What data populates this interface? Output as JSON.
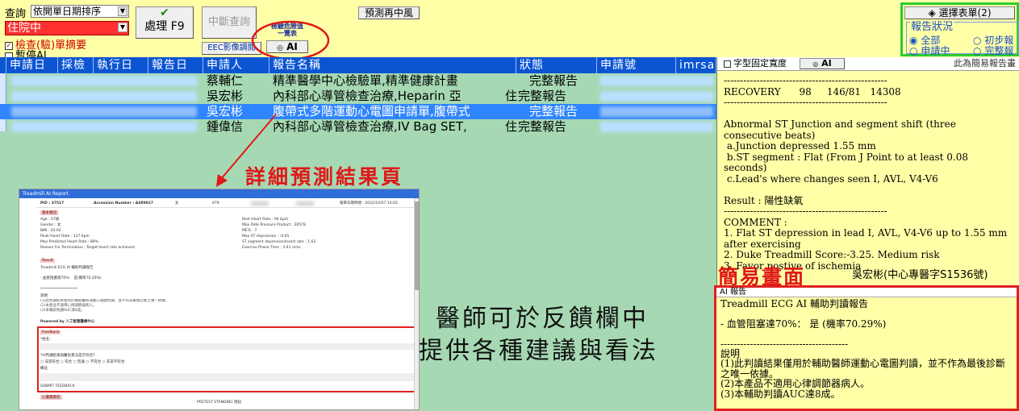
{
  "toolbar": {
    "query_label": "查詢",
    "sort_value": "依開單日期排序",
    "ward_value": "住院中",
    "exam_summary_label": "檢查(驗)單摘要",
    "pause_ai_label": "暫停AI",
    "process_button": "處理 F9",
    "interrupt_button": "中斷查詢",
    "eec_button": "EEC影像調閱",
    "critical_values_label_1": "檢驗危險值",
    "critical_values_label_2": "一覽表",
    "ai_button": "AI",
    "predict_button": "預測再中風",
    "select_form_button": "選擇表單(2)",
    "report_status_label": "報告狀況",
    "status_all": "全部",
    "status_applying": "申請中",
    "status_preliminary": "初步報",
    "status_complete": "完整報"
  },
  "table": {
    "headers": [
      "申請日",
      "採檢",
      "執行日",
      "報告日",
      "申請人",
      "報告名稱",
      "狀態",
      "申請號",
      "imrsan"
    ],
    "rows": [
      {
        "applicant": "蔡輔仁",
        "report": "精準醫學中心檢驗單,精準健康計畫",
        "status": "完整報告"
      },
      {
        "applicant": "吳宏彬",
        "report": "內科部心導管檢查治療,Heparin 亞",
        "status": "完整報告",
        "status_prefix": "住"
      },
      {
        "applicant": "吳宏彬",
        "report": "腹帶式多階運動心電圖申請單,腹帶式",
        "status": "完整報告"
      },
      {
        "applicant": "鍾偉信",
        "report": "內科部心導管檢查治療,IV Bag SET,",
        "status": "完整報告",
        "status_prefix": "住"
      }
    ]
  },
  "right_panel": {
    "fixed_width_label": "字型固定寬度",
    "ai_button": "AI",
    "simple_report_note": "此為簡易報告畫",
    "report_text": "--------------------------------------------------\nRECOVERY      98     146/81   14308\n--------------------------------------------------\n\nAbnormal ST Junction and segment shift (three consecutive beats)\n a.Junction depressed 1.55 mm\n b.ST segment : Flat (From J Point to at least 0.08 seconds)\n c.Lead's where changes seen I, AVL, V4-V6\n\nResult : 陽性缺氧\n--------------------------------------------------\nCOMMENT :\n1. Flat ST depression in lead I, AVL, V4-V6 up to 1.55 mm after exercising\n2. Duke Treadmill Score:-3.25. Medium risk\n3. Favor postive of ischemia",
    "signature": "吳宏彬(中心專醫字S1536號)"
  },
  "ai_report": {
    "header": "AI 報告",
    "text": "Treadmill ECG AI 輔助判讀報告\n\n- 血管阻塞達70%： 是 (機率70.29%)\n\n---------------------------------------\n說明\n(1)此判讀結果僅用於輔助醫師運動心電圖判讀，並不作為最後診斷之唯一依據。\n(2)本產品不適用心律調節器病人。\n(3)本輔助判讀AUC達8成。"
  },
  "annotations": {
    "detail_page": "詳細預測結果頁",
    "simple_screen": "簡易畫面",
    "feedback_line1": "醫師可於反饋欄中",
    "feedback_line2": "提供各種建議與看法"
  },
  "thumbnail": {
    "title": "Treadmill AI Report",
    "pid": "PID : 37517",
    "accession": "Accession Number : A489927",
    "gender_col": "女",
    "num_col": "679",
    "date_header": "報單日期時間 : 2022/10/07 14:03",
    "section_basic": "基本資訊",
    "age": "Age : 67歲",
    "gender": "Gender : 女",
    "bmi": "BMI : 24.92",
    "peak_hr": "Peak Heart Rate : 137 bpm",
    "max_pred_hr": "Max Predicted Heart Rate : 89%",
    "termination": "Reason For Termination : Target heart rate achieved",
    "rest_hr": "Rest Heart Rate : 94 bpm",
    "max_rpp": "Max Rate Pressure Product : 26578",
    "mets": "METs : 7",
    "max_st": "Max ST depression : -0.65",
    "st_slope": "ST segment depression/heart rate : 1.62",
    "exercise_time": "Exercise Phase Time : 3:41 mins",
    "section_result": "Result",
    "result_text": "Treadmill ECG AI 輔助判讀報告",
    "result_line": "- 血管阻塞達70%： 是(機率70.29%)",
    "powered_by": "Powered by 人工智慧醫療中心",
    "feedback_label": "Feedback",
    "feedback_q": "*AI判讀結果與醫生看法是否符合？",
    "feedback_options": "○ 非常符合  ○ 符合  ○ 普通  ○ 不符合  ○ 非常不符合",
    "remark_label": "備註",
    "submit": "SUBMIT FEEDBACK",
    "pretest": "PRETEST STANDING 階段",
    "next_section": "心電圖資訊"
  }
}
